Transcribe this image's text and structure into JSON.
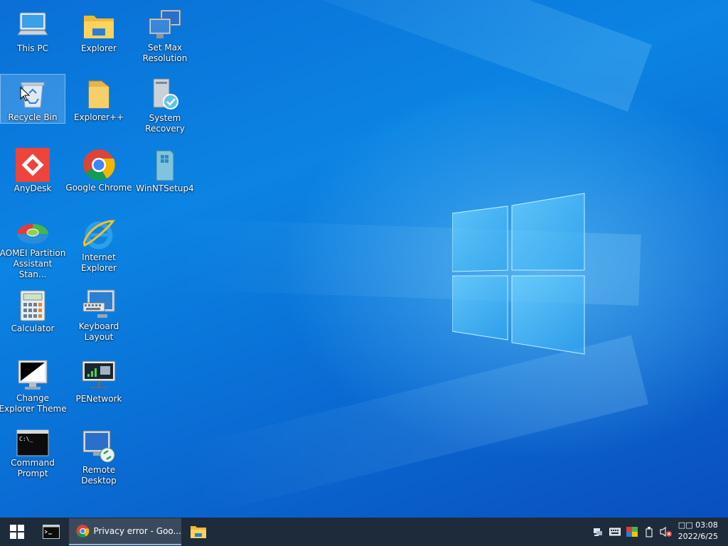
{
  "desktop": {
    "icons": [
      {
        "label": "This PC"
      },
      {
        "label": "Explorer"
      },
      {
        "label": "Set Max Resolution"
      },
      {
        "label": "Recycle Bin"
      },
      {
        "label": "Explorer++"
      },
      {
        "label": "System Recovery"
      },
      {
        "label": "AnyDesk"
      },
      {
        "label": "Google Chrome"
      },
      {
        "label": "WinNTSetup4"
      },
      {
        "label": "AOMEI Partition Assistant Stan..."
      },
      {
        "label": "Internet Explorer"
      },
      {
        "label": "Calculator"
      },
      {
        "label": "Keyboard Layout"
      },
      {
        "label": "Change Explorer Theme"
      },
      {
        "label": "PENetwork"
      },
      {
        "label": "Command Prompt"
      },
      {
        "label": "Remote Desktop"
      }
    ]
  },
  "taskbar": {
    "chrome_window_title": "Privacy error - Goo...",
    "clock": {
      "time": "03:08",
      "date": "2022/6/25",
      "ime": "□□"
    }
  },
  "colors": {
    "taskbar_bg": "#1e2b3a",
    "active_task": "#3a4a5c",
    "desktop_blue": "#0b84e3"
  }
}
